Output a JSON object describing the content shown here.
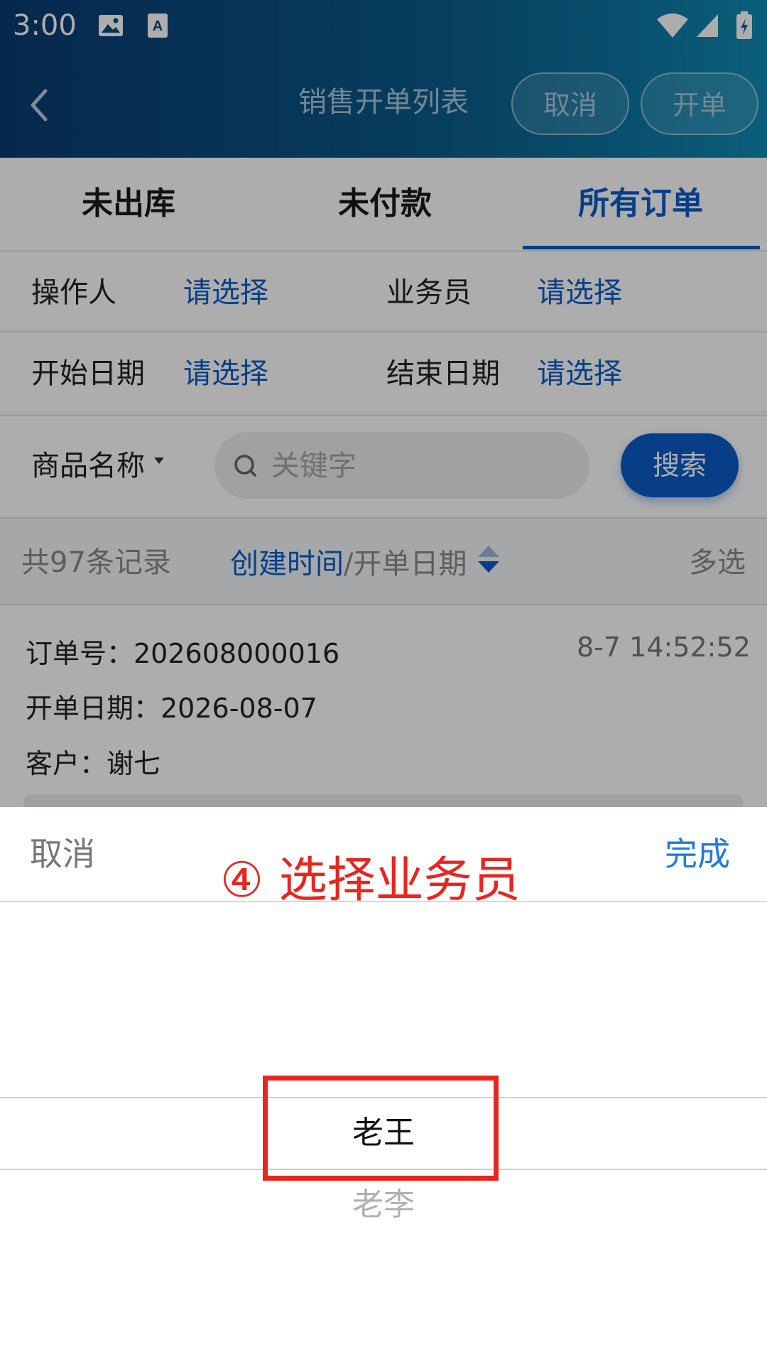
{
  "status_bar": {
    "time": "3:00"
  },
  "header": {
    "back_icon": "chevron-left-icon",
    "title": "销售开单列表",
    "cancel_label": "取消",
    "create_label": "开单"
  },
  "tabs": [
    {
      "label": "未出库",
      "active": false
    },
    {
      "label": "未付款",
      "active": false
    },
    {
      "label": "所有订单",
      "active": true
    }
  ],
  "filters": {
    "operator_label": "操作人",
    "operator_value": "请选择",
    "salesman_label": "业务员",
    "salesman_value": "请选择",
    "start_label": "开始日期",
    "start_value": "请选择",
    "end_label": "结束日期",
    "end_value": "请选择"
  },
  "search": {
    "field_label": "商品名称",
    "placeholder": "关键字",
    "button_label": "搜索"
  },
  "list_info": {
    "count": "共97条记录",
    "sort_active": "创建时间",
    "sort_sep": "/",
    "sort_other": "开单日期",
    "multi_select": "多选"
  },
  "order": {
    "order_no": "订单号：202608000016",
    "date": "开单日期：2026-08-07",
    "customer": "客户：谢七",
    "time": "8-7 14:52:52"
  },
  "picker": {
    "cancel": "取消",
    "done": "完成",
    "annotation": "④ 选择业务员",
    "options": [
      "老王",
      "老李"
    ],
    "selected_index": 0
  },
  "colors": {
    "accent": "#0b5cc7",
    "annotation": "#e8251f",
    "done": "#1f7ae0"
  }
}
